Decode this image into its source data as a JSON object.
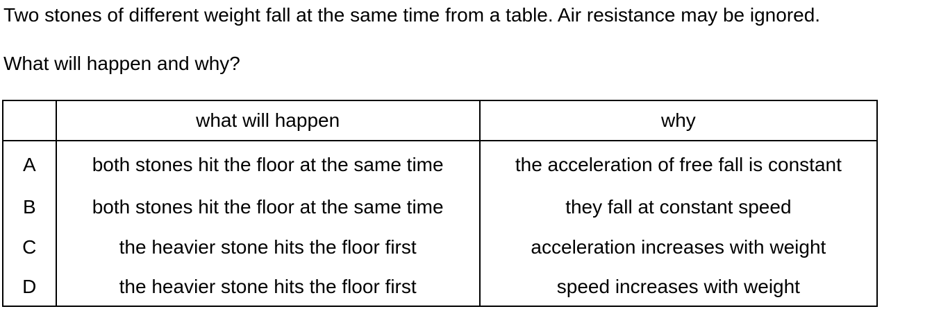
{
  "question": {
    "line1": "Two stones of different weight fall at the same time from a table. Air resistance may be ignored.",
    "line2": "What will happen and why?"
  },
  "table": {
    "headers": {
      "letter": "",
      "what": "what will happen",
      "why": "why"
    },
    "rows": [
      {
        "letter": "A",
        "what": "both stones hit the floor at the same time",
        "why": "the acceleration of free fall is constant"
      },
      {
        "letter": "B",
        "what": "both stones hit the floor at the same time",
        "why": "they fall at constant speed"
      },
      {
        "letter": "C",
        "what": "the heavier stone hits the floor first",
        "why": "acceleration increases with weight"
      },
      {
        "letter": "D",
        "what": "the heavier stone hits the floor first",
        "why": "speed increases with weight"
      }
    ]
  }
}
